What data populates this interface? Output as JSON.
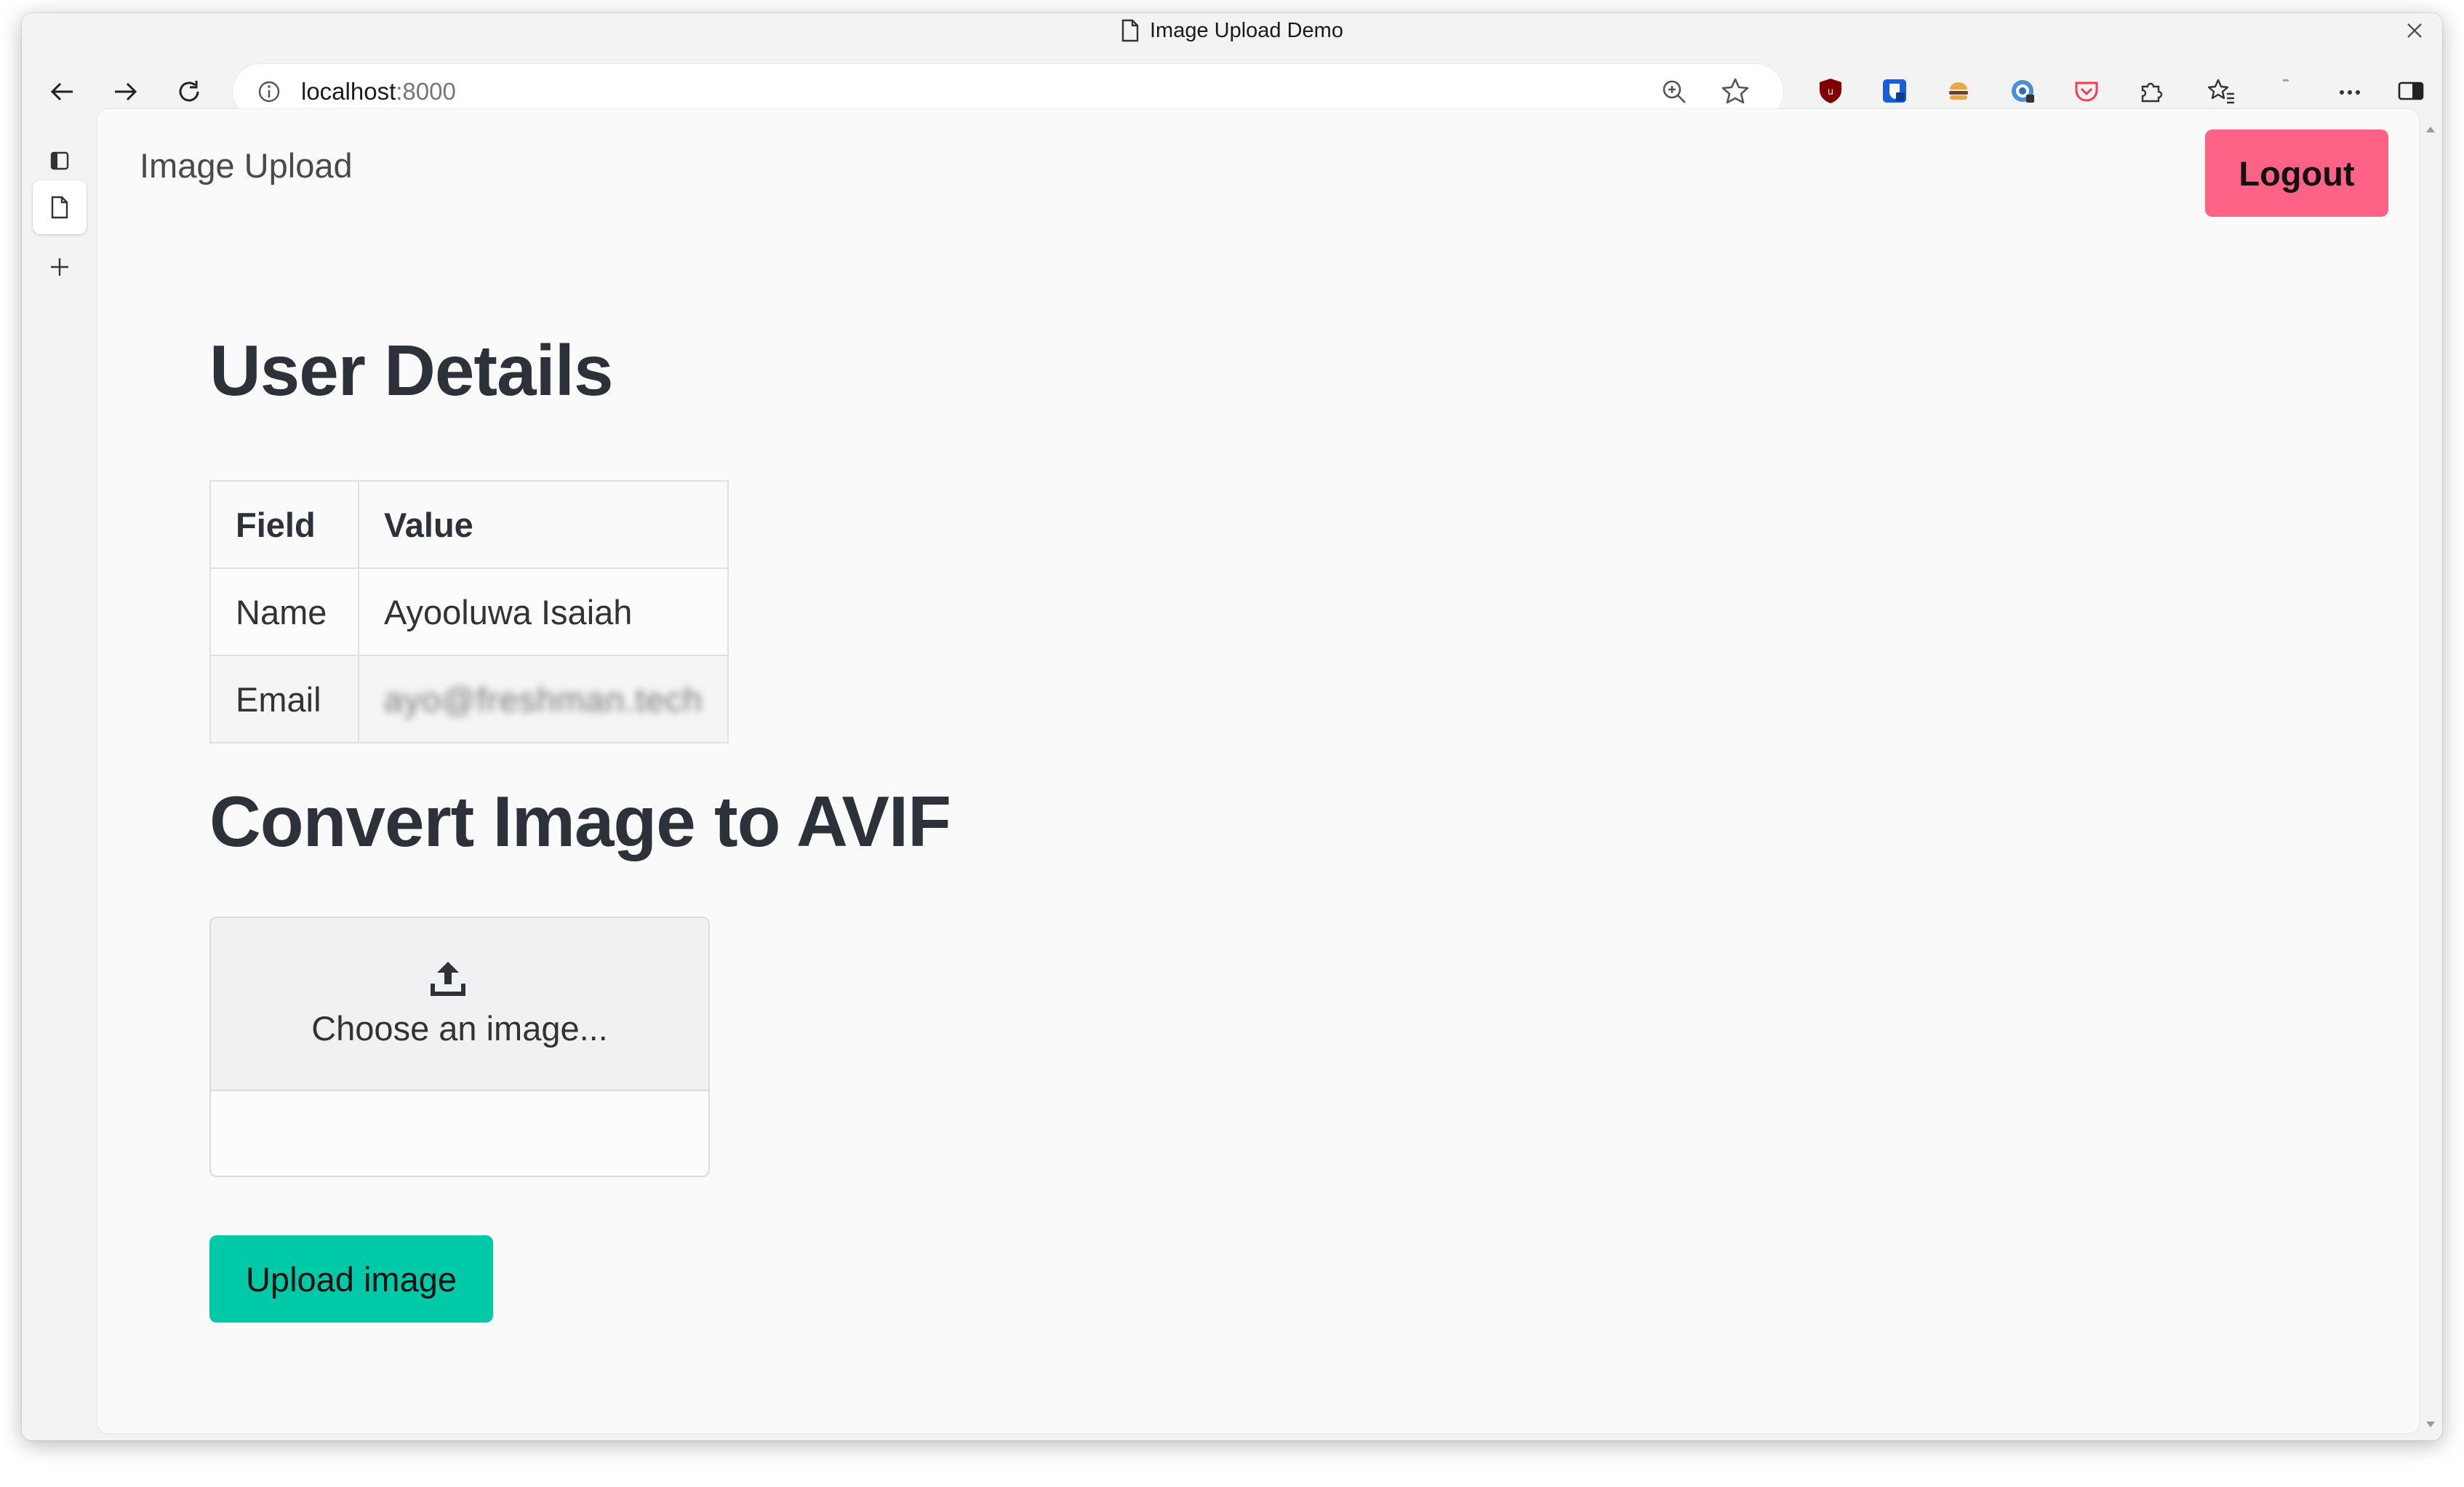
{
  "browser": {
    "tab_title": "Image Upload Demo",
    "url_host": "localhost",
    "url_port": ":8000"
  },
  "navbar": {
    "brand": "Image Upload",
    "logout_label": "Logout"
  },
  "user_details": {
    "heading": "User Details",
    "columns": [
      "Field",
      "Value"
    ],
    "rows": [
      {
        "field": "Name",
        "value": "Ayooluwa Isaiah"
      },
      {
        "field": "Email",
        "value": "ayo@freshman.tech"
      }
    ]
  },
  "converter": {
    "heading": "Convert Image to AVIF",
    "choose_label": "Choose an image...",
    "file_name": "",
    "upload_label": "Upload image"
  },
  "colors": {
    "logout": "#ff6287",
    "upload": "#00c9a7",
    "heading": "#2d323a"
  }
}
